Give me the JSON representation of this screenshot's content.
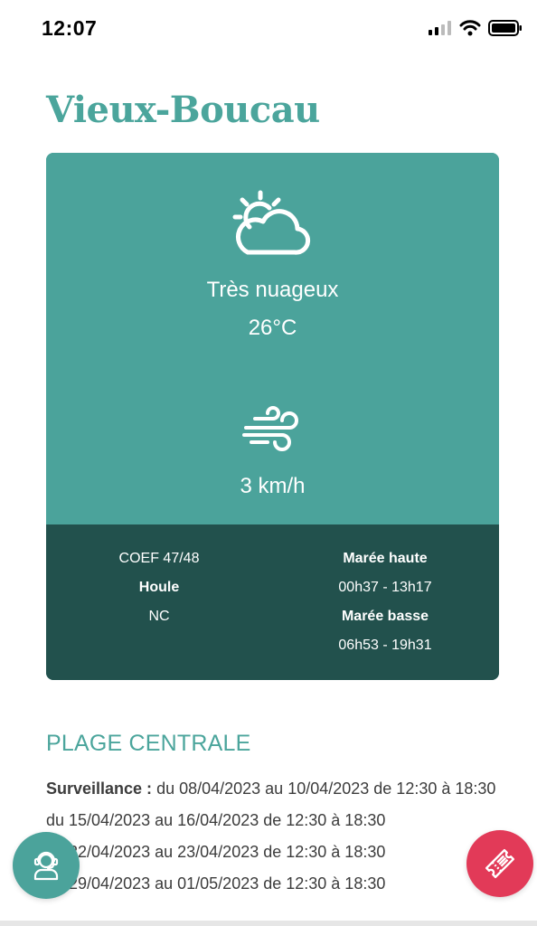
{
  "status_bar": {
    "time": "12:07"
  },
  "city": {
    "name": "Vieux-Boucau"
  },
  "weather": {
    "condition": "Très nuageux",
    "temperature": "26°C",
    "wind_speed": "3 km/h",
    "icons": [
      "partly-cloudy-sun-icon",
      "wind-icon"
    ]
  },
  "tide": {
    "coef": "COEF 47/48",
    "houle_label": "Houle",
    "houle_value": "NC",
    "high_label": "Marée haute",
    "high_times": "00h37 - 13h17",
    "low_label": "Marée basse",
    "low_times": "06h53 - 19h31"
  },
  "beach": {
    "title": "PLAGE CENTRALE",
    "surveillance_label": "Surveillance :",
    "lines": [
      " du 08/04/2023 au 10/04/2023 de 12:30 à 18:30",
      "du 15/04/2023 au 16/04/2023 de 12:30 à 18:30",
      "du 22/04/2023 au 23/04/2023 de 12:30 à 18:30",
      "du 29/04/2023 au 01/05/2023 de 12:30 à 18:30"
    ]
  },
  "colors": {
    "accent": "#4ba39b",
    "dark_panel": "#22514d",
    "ticket_button": "#e23a58"
  }
}
